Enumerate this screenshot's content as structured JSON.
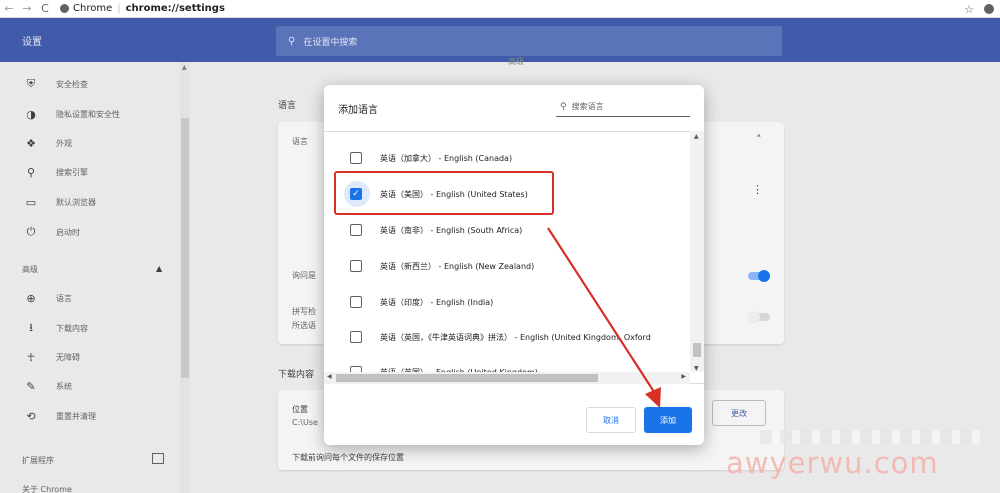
{
  "browser": {
    "back": "←",
    "forward": "→",
    "reload": "C",
    "origin": "Chrome",
    "url": "chrome://settings",
    "star": "☆",
    "profile": "👤"
  },
  "header": {
    "title": "设置",
    "search_placeholder": "在设置中搜索"
  },
  "sidebar": {
    "items": [
      {
        "icon": "shield-check-icon",
        "glyph": "⛨",
        "label": "安全检查"
      },
      {
        "icon": "shield-icon",
        "glyph": "◑",
        "label": "隐私设置和安全性"
      },
      {
        "icon": "palette-icon",
        "glyph": "❖",
        "label": "外观"
      },
      {
        "icon": "search-icon",
        "glyph": "⚲",
        "label": "搜索引擎"
      },
      {
        "icon": "browser-icon",
        "glyph": "▭",
        "label": "默认浏览器"
      },
      {
        "icon": "power-icon",
        "glyph": "⏻",
        "label": "启动时"
      }
    ],
    "advanced_label": "高级",
    "advanced_caret": "▲",
    "advanced_items": [
      {
        "icon": "globe-icon",
        "glyph": "⊕",
        "label": "语言"
      },
      {
        "icon": "download-icon",
        "glyph": "⭳",
        "label": "下载内容"
      },
      {
        "icon": "accessibility-icon",
        "glyph": "☥",
        "label": "无障碍"
      },
      {
        "icon": "wrench-icon",
        "glyph": "✎",
        "label": "系统"
      },
      {
        "icon": "restore-icon",
        "glyph": "⟲",
        "label": "重置并清理"
      }
    ],
    "extensions_label": "扩展程序",
    "about_label": "关于 Chrome"
  },
  "page": {
    "language_section": "语言",
    "language_card_label": "语言",
    "ask_translate": "询问是",
    "spellcheck": "拼写检",
    "spellcheck_sub": "所选语",
    "top_partial": "高级",
    "downloads_section": "下载内容",
    "location_label": "位置",
    "location_value": "C:\\Use",
    "ask_where": "下载前询问每个文件的保存位置",
    "change_button": "更改",
    "expand_caret": "˄",
    "more_menu": "⋮"
  },
  "dialog": {
    "title": "添加语言",
    "search_placeholder": "搜索语言",
    "languages": [
      {
        "label": "英语（加拿大） - English (Canada)",
        "checked": false
      },
      {
        "label": "英语（美国） - English (United States)",
        "checked": true
      },
      {
        "label": "英语（南非） - English (South Africa)",
        "checked": false
      },
      {
        "label": "英语（新西兰） - English (New Zealand)",
        "checked": false
      },
      {
        "label": "英语（印度） - English (India)",
        "checked": false
      },
      {
        "label": "英语（英国，《牛津英语词典》拼法） - English (United Kingdom, Oxford",
        "checked": false
      },
      {
        "label": "英语（英国） - English (United Kingdom)",
        "checked": false
      }
    ],
    "cancel_label": "取消",
    "add_label": "添加"
  },
  "watermark": "awyerwu.com",
  "colors": {
    "header": "#3f5ba9",
    "accent": "#1a73e8",
    "annotation": "#d93025"
  }
}
